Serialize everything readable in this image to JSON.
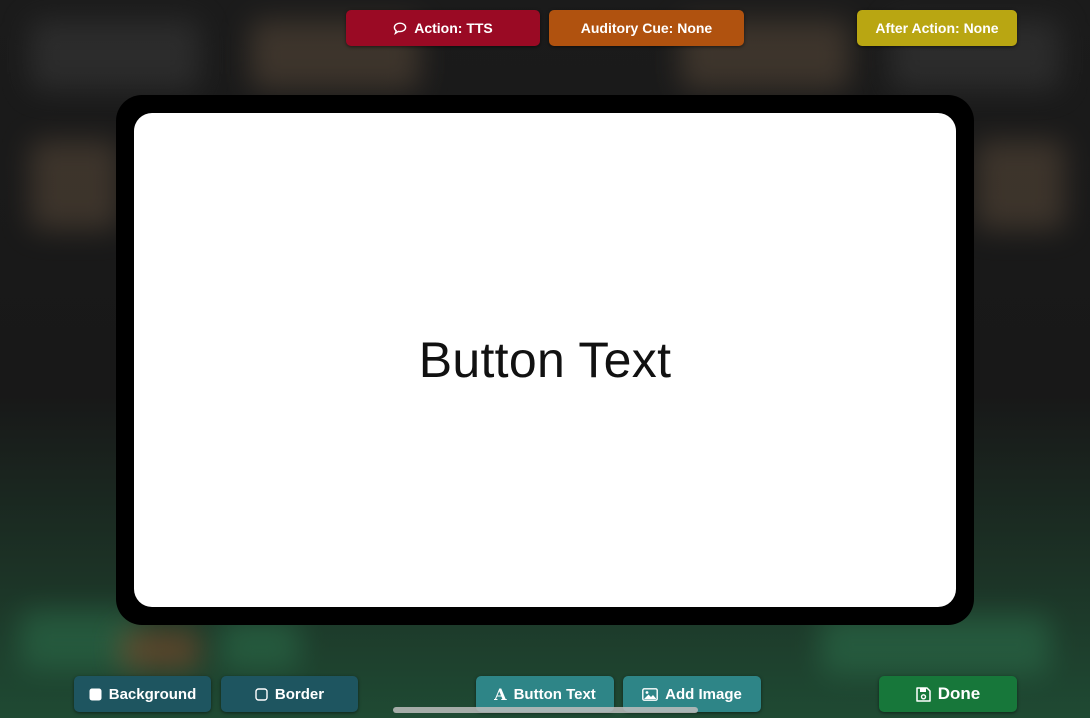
{
  "top_bar": {
    "action_label": "Action: TTS",
    "auditory_cue_label": "Auditory Cue: None",
    "after_action_label": "After Action: None"
  },
  "preview": {
    "button_text": "Button Text"
  },
  "toolbar": {
    "background_label": "Background",
    "border_label": "Border",
    "button_text_label": "Button Text",
    "button_text_glyph": "A",
    "add_image_label": "Add Image",
    "done_label": "Done"
  },
  "colors": {
    "action": "#9a0a24",
    "auditory_cue": "#b0520f",
    "after_action": "#b9a612",
    "tool_dark_teal": "#1e5560",
    "tool_light_teal": "#2e8587",
    "done": "#17773a",
    "card_border": "#000000",
    "card_fill": "#ffffff"
  },
  "icons": {
    "action": "speech-bubble-icon",
    "background": "filled-square-icon",
    "border": "outline-square-icon",
    "button_text": "letter-a-icon",
    "add_image": "image-icon",
    "done": "floppy-disk-icon"
  }
}
